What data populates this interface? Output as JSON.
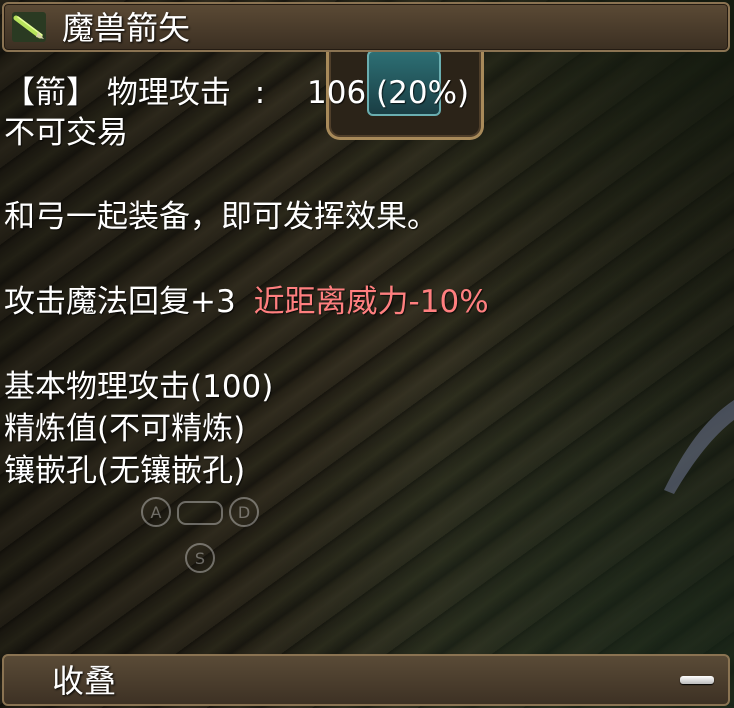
{
  "header": {
    "icon": "arrow-item-icon",
    "title": "魔兽箭矢"
  },
  "background": {
    "slot_icon": "equipment-slot-icon",
    "pad_labels": [
      "A",
      "D",
      "S"
    ]
  },
  "stats": {
    "type_label": "【箭】",
    "attack_label": "物理攻击",
    "colon": ":",
    "attack_value": "106 (20%)",
    "tradable": "不可交易",
    "equip_note": "和弓一起装备，即可发挥效果。",
    "magic_recovery": "攻击魔法回复+3",
    "melee_penalty": "近距离威力-10%",
    "base_attack": "基本物理攻击(100)",
    "refine": "精炼值(不可精炼)",
    "socket": "镶嵌孔(无镶嵌孔)"
  },
  "footer": {
    "collapse_label": "收叠",
    "collapse_icon": "minus-icon"
  },
  "colors": {
    "text": "#ffffff",
    "penalty": "#ff7f7f",
    "frame": "#8a7352"
  }
}
